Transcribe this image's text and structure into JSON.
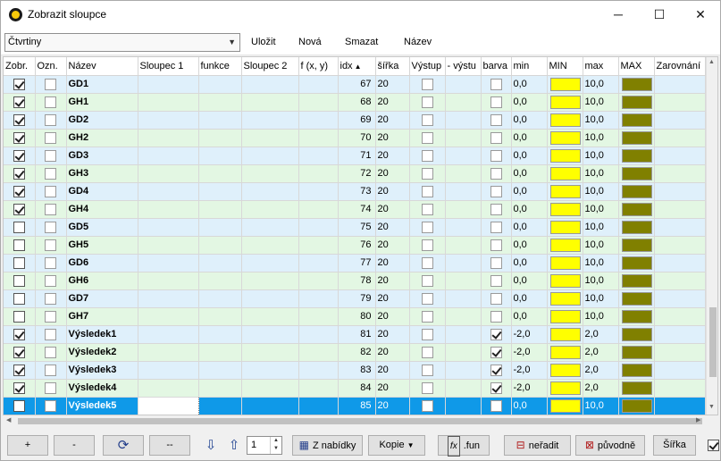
{
  "window": {
    "title": "Zobrazit sloupce",
    "minimize": "─",
    "maximize": "☐",
    "close": "✕"
  },
  "toolbar": {
    "preset_value": "Čtvrtiny",
    "save_label": "Uložit",
    "new_label": "Nová",
    "delete_label": "Smazat",
    "name_label": "Název"
  },
  "columns": [
    "Zobr.",
    "Ozn.",
    "Název",
    "Sloupec 1",
    "funkce",
    "Sloupec 2",
    "f (x, y)",
    "idx",
    "šířka",
    "Výstup",
    "- výstu",
    "barva",
    "min",
    "MIN",
    "max",
    "MAX",
    "Zarovnání"
  ],
  "sort_indicator": "▲",
  "colors": {
    "min_color": "#ffff00",
    "max_color": "#808000",
    "selection": "#0f99e8",
    "row_even": "#dff0fb",
    "row_odd": "#e3f7e3"
  },
  "rows": [
    {
      "show": true,
      "mark": false,
      "name": "GD1",
      "idx": "67",
      "width": "20",
      "output": false,
      "color": false,
      "min": "0,0",
      "max": "10,0"
    },
    {
      "show": true,
      "mark": false,
      "name": "GH1",
      "idx": "68",
      "width": "20",
      "output": false,
      "color": false,
      "min": "0,0",
      "max": "10,0"
    },
    {
      "show": true,
      "mark": false,
      "name": "GD2",
      "idx": "69",
      "width": "20",
      "output": false,
      "color": false,
      "min": "0,0",
      "max": "10,0"
    },
    {
      "show": true,
      "mark": false,
      "name": "GH2",
      "idx": "70",
      "width": "20",
      "output": false,
      "color": false,
      "min": "0,0",
      "max": "10,0"
    },
    {
      "show": true,
      "mark": false,
      "name": "GD3",
      "idx": "71",
      "width": "20",
      "output": false,
      "color": false,
      "min": "0,0",
      "max": "10,0"
    },
    {
      "show": true,
      "mark": false,
      "name": "GH3",
      "idx": "72",
      "width": "20",
      "output": false,
      "color": false,
      "min": "0,0",
      "max": "10,0"
    },
    {
      "show": true,
      "mark": false,
      "name": "GD4",
      "idx": "73",
      "width": "20",
      "output": false,
      "color": false,
      "min": "0,0",
      "max": "10,0"
    },
    {
      "show": true,
      "mark": false,
      "name": "GH4",
      "idx": "74",
      "width": "20",
      "output": false,
      "color": false,
      "min": "0,0",
      "max": "10,0"
    },
    {
      "show": false,
      "mark": false,
      "name": "GD5",
      "idx": "75",
      "width": "20",
      "output": false,
      "color": false,
      "min": "0,0",
      "max": "10,0"
    },
    {
      "show": false,
      "mark": false,
      "name": "GH5",
      "idx": "76",
      "width": "20",
      "output": false,
      "color": false,
      "min": "0,0",
      "max": "10,0"
    },
    {
      "show": false,
      "mark": false,
      "name": "GD6",
      "idx": "77",
      "width": "20",
      "output": false,
      "color": false,
      "min": "0,0",
      "max": "10,0"
    },
    {
      "show": false,
      "mark": false,
      "name": "GH6",
      "idx": "78",
      "width": "20",
      "output": false,
      "color": false,
      "min": "0,0",
      "max": "10,0"
    },
    {
      "show": false,
      "mark": false,
      "name": "GD7",
      "idx": "79",
      "width": "20",
      "output": false,
      "color": false,
      "min": "0,0",
      "max": "10,0"
    },
    {
      "show": false,
      "mark": false,
      "name": "GH7",
      "idx": "80",
      "width": "20",
      "output": false,
      "color": false,
      "min": "0,0",
      "max": "10,0"
    },
    {
      "show": true,
      "mark": false,
      "name": "Výsledek1",
      "idx": "81",
      "width": "20",
      "output": false,
      "color": true,
      "min": "-2,0",
      "max": "2,0"
    },
    {
      "show": true,
      "mark": false,
      "name": "Výsledek2",
      "idx": "82",
      "width": "20",
      "output": false,
      "color": true,
      "min": "-2,0",
      "max": "2,0"
    },
    {
      "show": true,
      "mark": false,
      "name": "Výsledek3",
      "idx": "83",
      "width": "20",
      "output": false,
      "color": true,
      "min": "-2,0",
      "max": "2,0"
    },
    {
      "show": true,
      "mark": false,
      "name": "Výsledek4",
      "idx": "84",
      "width": "20",
      "output": false,
      "color": true,
      "min": "-2,0",
      "max": "2,0"
    },
    {
      "show": false,
      "mark": false,
      "name": "Výsledek5",
      "idx": "85",
      "width": "20",
      "output": false,
      "color": false,
      "min": "0,0",
      "max": "10,0",
      "selected": true
    }
  ],
  "bottom": {
    "plus": "+",
    "minus": "-",
    "refresh_icon": "⟳",
    "dashes": "--",
    "down_icon": "⇩",
    "up_icon": "⇧",
    "spin_value": "1",
    "menu_label": "Z nabídky",
    "copy_label": "Kopie",
    "fun_label": ".fun",
    "unsort_label": "neřadit",
    "original_label": "původně",
    "width_label": "Šířka",
    "final_checked": true
  }
}
